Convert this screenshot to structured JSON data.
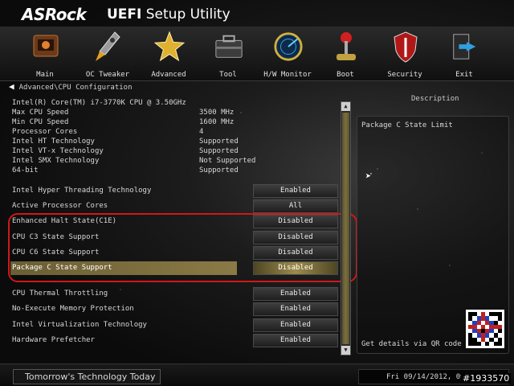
{
  "header": {
    "brand": "ASRock",
    "title_bold": "UEFI",
    "title_rest": "Setup Utility"
  },
  "nav": [
    {
      "label": "Main",
      "icon": "main-icon"
    },
    {
      "label": "OC Tweaker",
      "icon": "rocket-icon"
    },
    {
      "label": "Advanced",
      "icon": "star-icon"
    },
    {
      "label": "Tool",
      "icon": "toolbox-icon"
    },
    {
      "label": "H/W Monitor",
      "icon": "radar-icon"
    },
    {
      "label": "Boot",
      "icon": "joystick-icon"
    },
    {
      "label": "Security",
      "icon": "shield-icon"
    },
    {
      "label": "Exit",
      "icon": "exit-icon"
    }
  ],
  "breadcrumb": "Advanced\\CPU Configuration",
  "info": [
    {
      "label": "Intel(R) Core(TM) i7-3770K CPU @ 3.50GHz",
      "value": ""
    },
    {
      "label": "Max CPU Speed",
      "value": "3500 MHz"
    },
    {
      "label": "Min CPU Speed",
      "value": "1600 MHz"
    },
    {
      "label": "Processor Cores",
      "value": "4"
    },
    {
      "label": "Intel HT Technology",
      "value": "Supported"
    },
    {
      "label": "Intel VT-x Technology",
      "value": "Supported"
    },
    {
      "label": "Intel SMX Technology",
      "value": "Not Supported"
    },
    {
      "label": "64-bit",
      "value": "Supported"
    }
  ],
  "settings": [
    {
      "label": "Intel Hyper Threading Technology",
      "value": "Enabled"
    },
    {
      "label": "Active Processor Cores",
      "value": "All"
    },
    {
      "label": "Enhanced Halt State(C1E)",
      "value": "Disabled"
    },
    {
      "label": "CPU C3 State Support",
      "value": "Disabled"
    },
    {
      "label": "CPU C6 State Support",
      "value": "Disabled"
    },
    {
      "label": "Package C State Support",
      "value": "Disabled"
    },
    {
      "label": "CPU Thermal Throttling",
      "value": "Enabled"
    },
    {
      "label": "No-Execute Memory Protection",
      "value": "Enabled"
    },
    {
      "label": "Intel Virtualization Technology",
      "value": "Enabled"
    },
    {
      "label": "Hardware Prefetcher",
      "value": "Enabled"
    }
  ],
  "selected_index": 5,
  "description": {
    "title": "Description",
    "text": "Package C State Limit",
    "qr_text": "Get details via QR code"
  },
  "footer": {
    "tagline": "Tomorrow's Technology Today",
    "clock": "Fri 09/14/2012, 09:52:53"
  },
  "watermark": "#1933570",
  "colors": {
    "highlight": "#8a7a45",
    "annotation_box": "#d01818"
  }
}
